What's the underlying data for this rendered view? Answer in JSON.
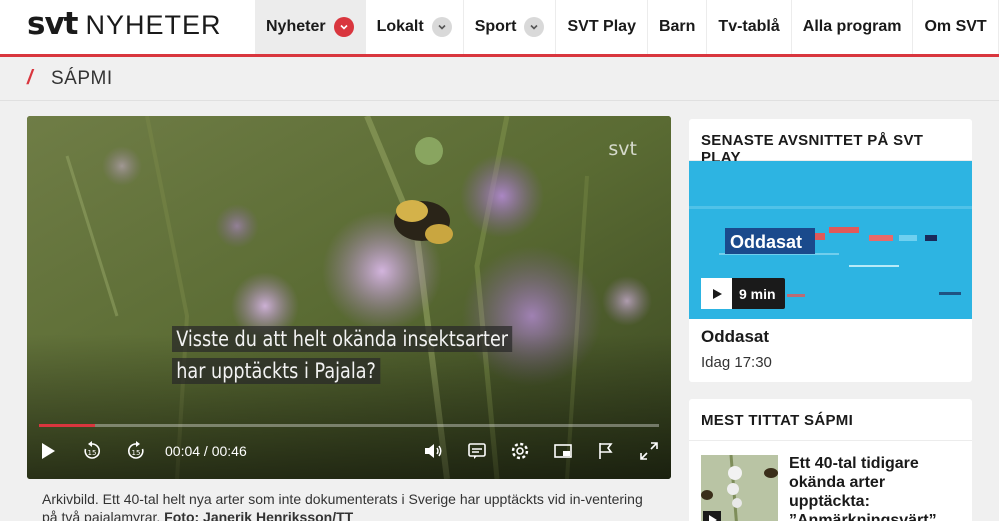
{
  "header": {
    "logo_svt": "svt",
    "logo_nyheter": "NYHETER",
    "nav": [
      {
        "label": "Nyheter",
        "dropdown": true
      },
      {
        "label": "Lokalt",
        "dropdown": true
      },
      {
        "label": "Sport",
        "dropdown": true
      },
      {
        "label": "SVT Play",
        "dropdown": false
      },
      {
        "label": "Barn",
        "dropdown": false
      },
      {
        "label": "Tv-tablå",
        "dropdown": false
      },
      {
        "label": "Alla program",
        "dropdown": false
      },
      {
        "label": "Om SVT",
        "dropdown": false
      }
    ]
  },
  "section": {
    "slash": "/",
    "title": "SÁPMI"
  },
  "video": {
    "watermark": "svt",
    "subtitle_line1": "Visste du att helt okända insektsarter",
    "subtitle_line2": "har upptäckts i Pajala?",
    "time_display": "00:04 / 00:46",
    "progress": 0.09
  },
  "caption": {
    "text": "Arkivbild. Ett 40-tal helt nya arter som inte dokumenterats i Sverige har upptäckts vid in-ventering på två pajalamyrar. ",
    "credit": "Foto: Janerik Henriksson/TT"
  },
  "latest_episode": {
    "heading": "SENASTE AVSNITTET PÅ SVT PLAY",
    "thumb_logo": "Oddasat",
    "duration": "9 min",
    "title": "Oddasat",
    "time": "Idag 17:30"
  },
  "most_watched": {
    "heading": "MEST TITTAT SÁPMI",
    "item_title": "Ett 40-tal tidigare okända arter upptäckta: ”Anmärkningsvärt”"
  },
  "colors": {
    "brand_red": "#d9363e",
    "play_blue": "#2db4e2"
  }
}
